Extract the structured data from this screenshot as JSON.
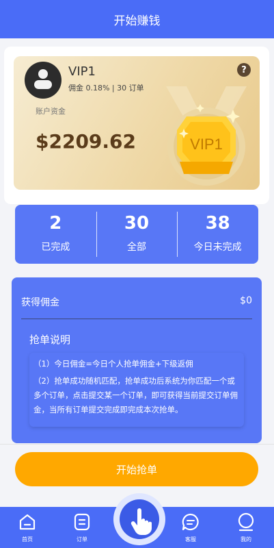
{
  "header": {
    "title": "开始赚钱"
  },
  "vip_card": {
    "level": "VIP1",
    "meta": "佣金 0.18% | 30 订单",
    "account_label": "账户资金",
    "balance": "$2209.62",
    "badge_text": "VIP1"
  },
  "stats": [
    {
      "value": "2",
      "label": "已完成"
    },
    {
      "value": "30",
      "label": "全部"
    },
    {
      "value": "38",
      "label": "今日未完成"
    }
  ],
  "commission": {
    "label": "获得佣金",
    "value": "$0",
    "rules_title": "抢单说明",
    "rules": [
      "（1）今日佣金=今日个人抢单佣金+下级返佣",
      "（2）抢单成功随机匹配，抢单成功后系统为你匹配一个或多个订单，点击提交某一个订单，即可获得当前提交订单佣金，当所有订单提交完成即完成本次抢单。"
    ]
  },
  "action": {
    "start_label": "开始抢单"
  },
  "tabbar": {
    "home": "首页",
    "orders": "订单",
    "service": "客服",
    "mine": "我的"
  },
  "colors": {
    "primary": "#4a6cf7",
    "card_blue": "#5877f6",
    "accent": "#ffa800"
  }
}
